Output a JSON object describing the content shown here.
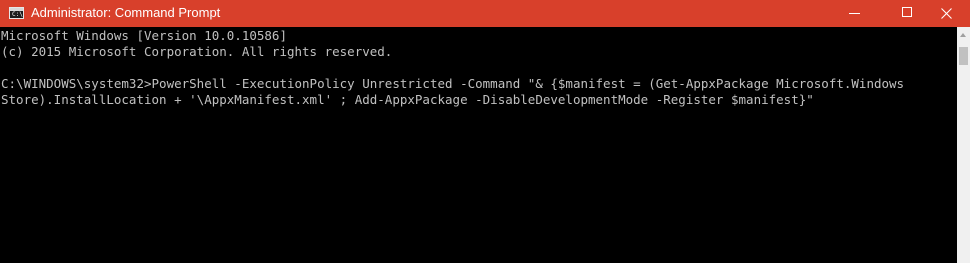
{
  "window": {
    "title": "Administrator: Command Prompt",
    "icon": "command-prompt-icon",
    "icon_text": "C:\\",
    "controls": [
      "minimize-icon",
      "maximize-icon",
      "close-icon"
    ]
  },
  "console": {
    "lines": [
      "Microsoft Windows [Version 10.0.10586]",
      "(c) 2015 Microsoft Corporation. All rights reserved.",
      "",
      "C:\\WINDOWS\\system32>PowerShell -ExecutionPolicy Unrestricted -Command \"& {$manifest = (Get-AppxPackage Microsoft.Windows",
      "Store).InstallLocation + '\\AppxManifest.xml' ; Add-AppxPackage -DisableDevelopmentMode -Register $manifest}\""
    ]
  },
  "colors": {
    "titlebar": "#d8402b",
    "console_background": "#000000",
    "console_text": "#c0c0c0"
  }
}
